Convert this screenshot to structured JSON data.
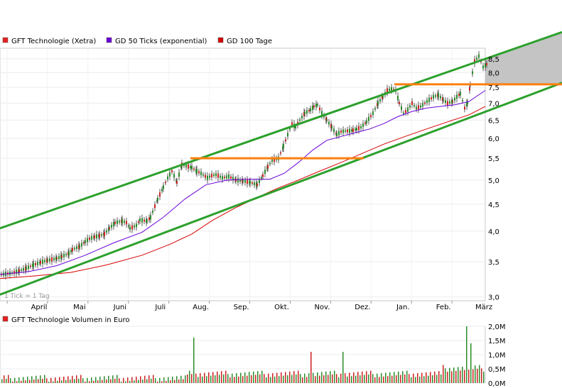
{
  "chart_data": [
    {
      "type": "line",
      "legend": [
        {
          "name": "GFT Technologie (Xetra)",
          "color": "#e81e1e"
        },
        {
          "name": "GD 50 Ticks (exponential)",
          "color": "#6a00d8"
        },
        {
          "name": "GD 100 Tage",
          "color": "#d80000"
        }
      ],
      "note": "1 Tick = 1 Tag",
      "months": [
        "April",
        "Mai",
        "Juni",
        "Juli",
        "Aug.",
        "Sep.",
        "Okt.",
        "Nov.",
        "Dez.",
        "Jan.",
        "Feb.",
        "März"
      ],
      "ylim": [
        2.95,
        8.9
      ],
      "y_scale": "log",
      "y_ticks": [
        "3,0",
        "3,5",
        "4,0",
        "4,5",
        "5,0",
        "5,5",
        "6,0",
        "6,5",
        "7,0",
        "7,5",
        "8,0",
        "8,5"
      ],
      "price": {
        "x": [
          0,
          15,
          25,
          35,
          45,
          55,
          65,
          78,
          85,
          95,
          100,
          110,
          118,
          124,
          131,
          138,
          145,
          152,
          160,
          170,
          176,
          181,
          190,
          195,
          205,
          210,
          220,
          228,
          234,
          240,
          247,
          254,
          260,
          268,
          275,
          281,
          290,
          296,
          302,
          311,
          320,
          330,
          340,
          350,
          360,
          368,
          375,
          381,
          390,
          397,
          403,
          409,
          414,
          420,
          427,
          435,
          440,
          445,
          451,
          458,
          465,
          472,
          478,
          484,
          490,
          495,
          500,
          506,
          514,
          523,
          530,
          537,
          543,
          549,
          555,
          560,
          566,
          572,
          578,
          584,
          590,
          596,
          602,
          608,
          615,
          622,
          628,
          635,
          641,
          646,
          652,
          656,
          660,
          666,
          672,
          678,
          683
        ],
        "y": [
          3.31,
          3.33,
          3.36,
          3.4,
          3.45,
          3.49,
          3.52,
          3.55,
          3.58,
          3.63,
          3.69,
          3.74,
          3.82,
          3.87,
          3.9,
          3.92,
          3.95,
          4.05,
          4.15,
          4.18,
          4.15,
          4.05,
          4.1,
          4.2,
          4.18,
          4.25,
          4.6,
          4.85,
          5.05,
          5.2,
          4.95,
          5.35,
          5.32,
          5.28,
          5.2,
          5.15,
          5.05,
          5.1,
          5.12,
          5.05,
          5.08,
          5.0,
          4.98,
          4.95,
          4.9,
          5.1,
          5.3,
          5.45,
          5.5,
          5.8,
          6.1,
          6.4,
          6.3,
          6.5,
          6.7,
          6.8,
          6.9,
          6.95,
          6.7,
          6.5,
          6.3,
          6.1,
          6.18,
          6.2,
          6.2,
          6.22,
          6.25,
          6.3,
          6.45,
          6.7,
          7.0,
          7.2,
          7.4,
          7.45,
          7.4,
          7.0,
          6.7,
          6.8,
          7.0,
          6.85,
          6.9,
          7.0,
          7.1,
          7.2,
          7.25,
          7.1,
          7.0,
          7.05,
          7.2,
          7.3,
          6.85,
          7.0,
          7.6,
          8.4,
          8.6,
          8.2,
          8.3
        ]
      },
      "gd50": {
        "x": [
          0,
          40,
          80,
          120,
          160,
          200,
          230,
          260,
          290,
          320,
          350,
          380,
          400,
          420,
          440,
          460,
          480,
          500,
          520,
          540,
          560,
          580,
          600,
          620,
          640,
          660,
          683
        ],
        "y": [
          3.31,
          3.35,
          3.44,
          3.6,
          3.8,
          3.98,
          4.25,
          4.6,
          4.9,
          5.0,
          5.02,
          5.02,
          5.15,
          5.4,
          5.7,
          5.95,
          6.05,
          6.15,
          6.25,
          6.4,
          6.6,
          6.75,
          6.85,
          6.9,
          6.95,
          7.05,
          7.4
        ]
      },
      "gd100": {
        "x": [
          0,
          50,
          100,
          150,
          200,
          240,
          270,
          300,
          330,
          360,
          390,
          420,
          450,
          480,
          510,
          540,
          570,
          600,
          630,
          660,
          683
        ],
        "y": [
          3.25,
          3.29,
          3.34,
          3.45,
          3.6,
          3.78,
          3.95,
          4.2,
          4.42,
          4.62,
          4.82,
          5.0,
          5.2,
          5.4,
          5.62,
          5.85,
          6.05,
          6.25,
          6.45,
          6.65,
          6.9
        ]
      },
      "trendlines": [
        {
          "color": "#2ca02c",
          "x": [
            0,
            791
          ],
          "y": [
            4.05,
            9.55
          ]
        },
        {
          "color": "#2ca02c",
          "x": [
            0,
            791
          ],
          "y": [
            3.03,
            7.65
          ]
        },
        {
          "color": "#ff7f0e",
          "x": [
            268,
            512
          ],
          "y": [
            5.5,
            5.5
          ]
        },
        {
          "color": "#ff7f0e",
          "x": [
            555,
            791
          ],
          "y": [
            7.6,
            7.6
          ]
        }
      ]
    },
    {
      "type": "bar",
      "legend": [
        {
          "name": "GFT Technologie Volumen in Euro",
          "color": "#e81e1e"
        }
      ],
      "ylim": [
        0,
        2.0
      ],
      "y_ticks": [
        "0,0M",
        "0,5M",
        "1,0M",
        "1,5M",
        "2,0M"
      ]
    }
  ]
}
